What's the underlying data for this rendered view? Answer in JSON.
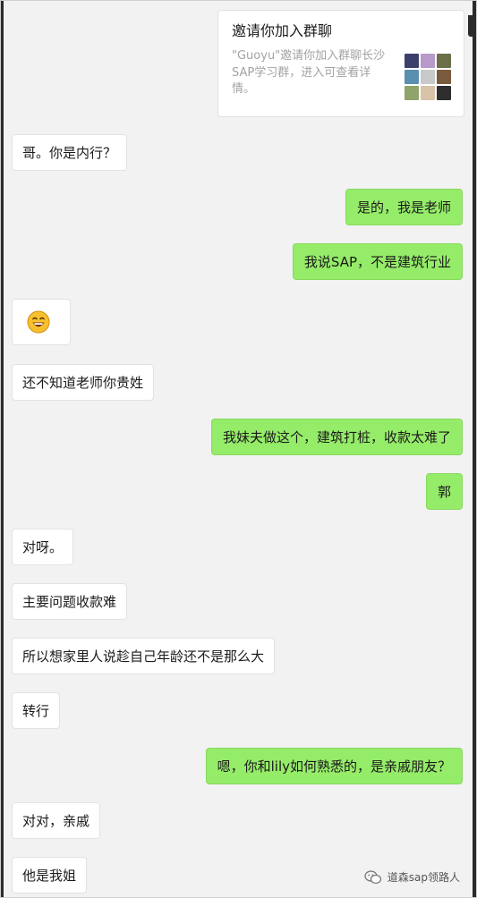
{
  "invite_card": {
    "title": "邀请你加入群聊",
    "description": "\"Guoyu\"邀请你加入群聊长沙SAP学习群，进入可查看详情。"
  },
  "messages": [
    {
      "side": "in",
      "text": "哥。你是内行？"
    },
    {
      "side": "out",
      "text": "是的，我是老师"
    },
    {
      "side": "out",
      "text": "我说SAP，不是建筑行业"
    },
    {
      "side": "in",
      "text": "",
      "emoji": "grinning-face-emoji"
    },
    {
      "side": "in",
      "text": "还不知道老师你贵姓"
    },
    {
      "side": "out",
      "text": "我妹夫做这个，建筑打桩，收款太难了"
    },
    {
      "side": "out",
      "text": "郭"
    },
    {
      "side": "in",
      "text": "对呀。"
    },
    {
      "side": "in",
      "text": "主要问题收款难"
    },
    {
      "side": "in",
      "text": "所以想家里人说趁自己年龄还不是那么大"
    },
    {
      "side": "in",
      "text": "转行"
    },
    {
      "side": "out",
      "text": "嗯，你和lily如何熟悉的，是亲戚朋友？"
    },
    {
      "side": "in",
      "text": "对对，亲戚"
    },
    {
      "side": "in",
      "text": "他是我姐"
    }
  ],
  "watermark": {
    "text": "道森sap领路人",
    "icon": "wechat-official-account-icon"
  },
  "colors": {
    "background": "#f2f2f2",
    "incoming_bubble": "#ffffff",
    "outgoing_bubble": "#95ec69",
    "invite_description": "#a3a3a3"
  }
}
